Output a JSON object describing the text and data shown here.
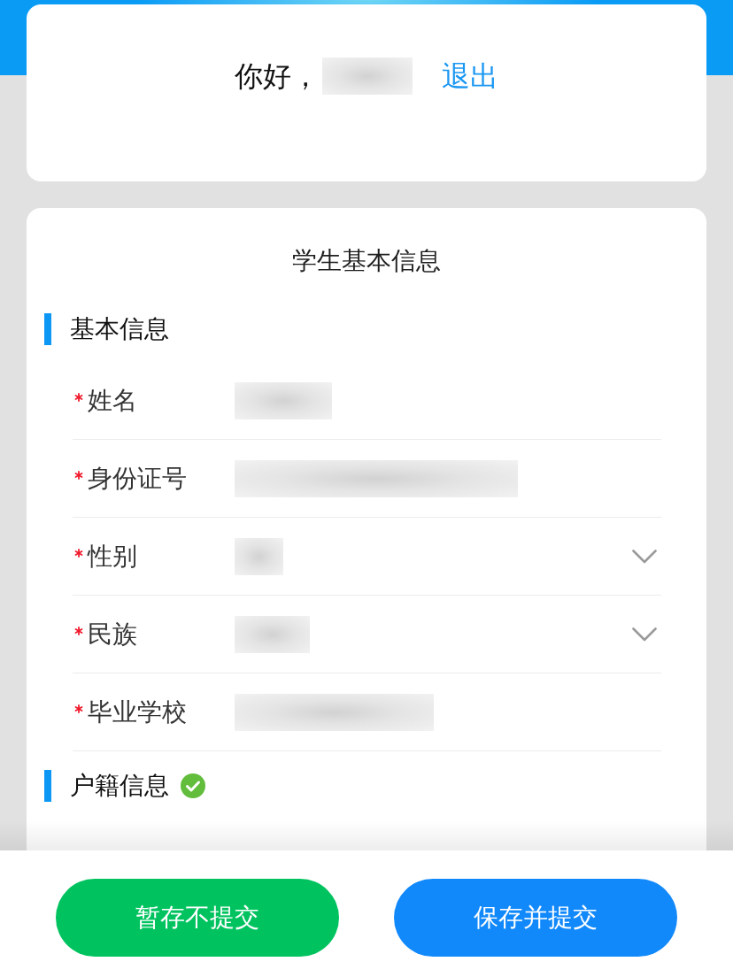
{
  "header": {
    "greeting": "你好，",
    "name_blurred": true,
    "logout": "退出"
  },
  "form": {
    "title": "学生基本信息",
    "sections": [
      {
        "title": "基本信息",
        "completed": false,
        "fields": [
          {
            "label": "姓名",
            "required": true,
            "kind": "text",
            "blurred": true
          },
          {
            "label": "身份证号",
            "required": true,
            "kind": "text",
            "blurred": true
          },
          {
            "label": "性别",
            "required": true,
            "kind": "select",
            "blurred": true
          },
          {
            "label": "民族",
            "required": true,
            "kind": "select",
            "blurred": true
          },
          {
            "label": "毕业学校",
            "required": true,
            "kind": "text",
            "blurred": true
          }
        ]
      },
      {
        "title": "户籍信息",
        "completed": true
      }
    ]
  },
  "actions": [
    {
      "label": "暂存不提交",
      "kind": "draft"
    },
    {
      "label": "保存并提交",
      "kind": "submit"
    }
  ]
}
